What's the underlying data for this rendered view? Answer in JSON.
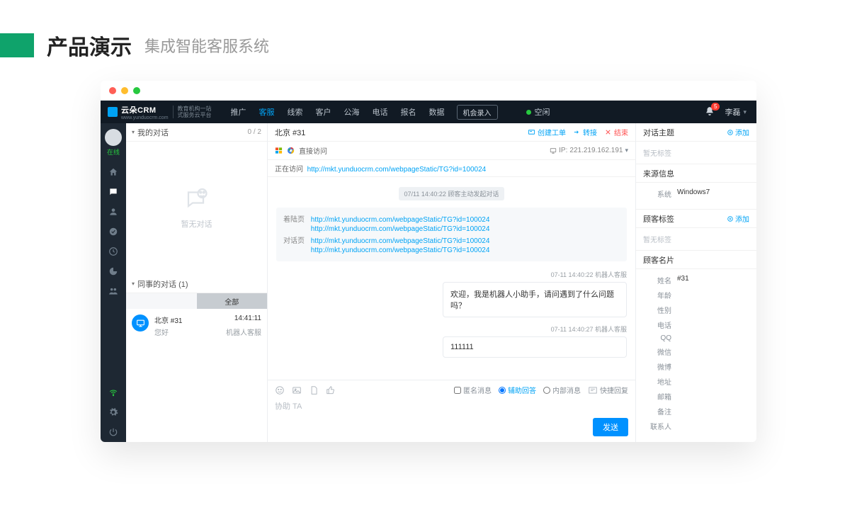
{
  "hero": {
    "title": "产品演示",
    "subtitle": "集成智能客服系统"
  },
  "brand": {
    "name": "云朵CRM",
    "sub1": "教育机构一站",
    "sub2": "式服务云平台",
    "site": "www.yunduocrm.com"
  },
  "nav": {
    "items": [
      "推广",
      "客服",
      "线索",
      "客户",
      "公海",
      "电话",
      "报名",
      "数据"
    ],
    "activeIndex": 1,
    "record": "机会录入",
    "status": "空闲",
    "notifications": "5",
    "user": "李磊"
  },
  "rail": {
    "status": "在线"
  },
  "conversations": {
    "mine": {
      "title": "我的对话",
      "count": "0 / 2",
      "empty": "暂无对话"
    },
    "colleague": {
      "title": "同事的对话  (1)",
      "tabs": [
        "",
        "全部"
      ],
      "activeTab": 1
    },
    "items": [
      {
        "name": "北京 #31",
        "preview": "您好",
        "time": "14:41:11",
        "agent": "机器人客服"
      }
    ]
  },
  "chat": {
    "title": "北京 #31",
    "actions": {
      "ticket": "创建工单",
      "transfer": "转接",
      "end": "结束"
    },
    "visit": {
      "label": "直接访问",
      "ip_label": "IP:",
      "ip": "221.219.162.191"
    },
    "current": {
      "label": "正在访问",
      "url": "http://mkt.yunduocrm.com/webpageStatic/TG?id=100024"
    },
    "timePill": "07/11 14:40:22  顾客主动发起对话",
    "pages": {
      "landingLabel": "着陆页",
      "dialogLabel": "对话页",
      "landing": [
        "http://mkt.yunduocrm.com/webpageStatic/TG?id=100024",
        "http://mkt.yunduocrm.com/webpageStatic/TG?id=100024"
      ],
      "dialog": [
        "http://mkt.yunduocrm.com/webpageStatic/TG?id=100024",
        "http://mkt.yunduocrm.com/webpageStatic/TG?id=100024"
      ]
    },
    "messages": [
      {
        "meta": "07-11 14:40:22  机器人客服",
        "text": "欢迎，我是机器人小助手，请问遇到了什么问题吗？"
      },
      {
        "meta": "07-11 14:40:27  机器人客服",
        "text": "111111"
      }
    ],
    "composer": {
      "anon": "匿名消息",
      "assist": "辅助回答",
      "internal": "内部消息",
      "quick": "快捷回复",
      "placeholder": "协助 TA",
      "send": "发送"
    }
  },
  "rightPane": {
    "topic": {
      "title": "对话主题",
      "add": "添加",
      "empty": "暂无标签"
    },
    "source": {
      "title": "来源信息",
      "rows": [
        {
          "k": "系统",
          "v": "Windows7"
        }
      ]
    },
    "tags": {
      "title": "顾客标签",
      "add": "添加",
      "empty": "暂无标签"
    },
    "card": {
      "title": "顾客名片",
      "rows": [
        {
          "k": "姓名",
          "v": "#31"
        },
        {
          "k": "年龄",
          "v": ""
        },
        {
          "k": "性别",
          "v": ""
        },
        {
          "k": "电话",
          "v": ""
        },
        {
          "k": "QQ",
          "v": ""
        },
        {
          "k": "微信",
          "v": ""
        },
        {
          "k": "微博",
          "v": ""
        },
        {
          "k": "地址",
          "v": ""
        },
        {
          "k": "邮箱",
          "v": ""
        },
        {
          "k": "备注",
          "v": ""
        },
        {
          "k": "联系人",
          "v": ""
        }
      ]
    }
  }
}
